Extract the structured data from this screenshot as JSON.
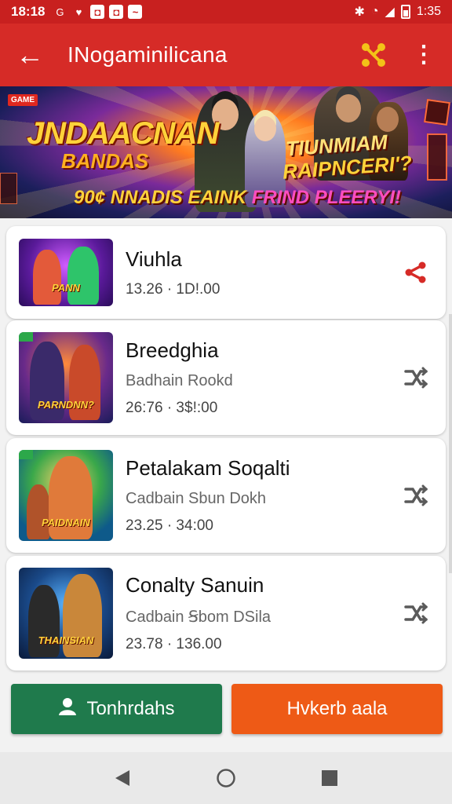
{
  "status_bar": {
    "time": "18:18",
    "left_icons": [
      "G",
      "♥",
      "◘",
      "◘",
      "~"
    ],
    "right_text": "1:35"
  },
  "appbar": {
    "back_icon": "←",
    "title": "INogaminilicana",
    "share_icon": "share-icon",
    "more_icon": "⋮",
    "accent": "#d62b27",
    "icon_color": "#f3c218"
  },
  "banner": {
    "tag": "GAME",
    "title_line1": "JNDAACNAN",
    "title_line2": "BANDAS",
    "right_line1": "TIUNMIAM",
    "right_line2": "RAIPNCERI'?",
    "bottom_line_a": "90¢ NNADIS EAINK ",
    "bottom_line_b": "FRIND PLEERYI!"
  },
  "items": [
    {
      "name": "Viuhla",
      "subtitle": "",
      "meta": "13.26 · 1D!.00",
      "thumb_caption": "PANN",
      "share_color": "#d62b27"
    },
    {
      "name": "Breedghia",
      "subtitle": "Badhain Rookd",
      "meta": "26:76 · 3$!:00",
      "thumb_caption": "PARNDNN?",
      "share_color": "#5a5a5a"
    },
    {
      "name": "Petalakam Soqalti",
      "subtitle": "Cadbain Sbun  Dokh",
      "meta": "23.25 · 34:00",
      "thumb_caption": "PAIDNAIN",
      "share_color": "#5a5a5a"
    },
    {
      "name": "Conalty Sanuin",
      "subtitle": "Cadbain Ꞩbom DSila",
      "meta": "23.78 · 136.00",
      "thumb_caption": "THAINSIAN",
      "share_color": "#5a5a5a"
    }
  ],
  "buttons": {
    "left_label": "Tonhrdahs",
    "right_label": "Hvkerb aala",
    "left_color": "#1f7a4c",
    "right_color": "#ee5a16"
  },
  "navbar": {
    "back": "back-icon",
    "home": "home-icon",
    "recents": "recents-icon"
  }
}
